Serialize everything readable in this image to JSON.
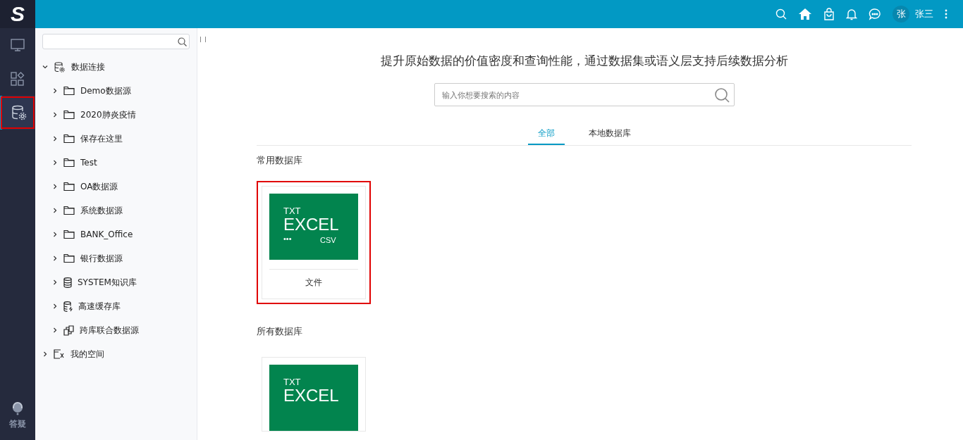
{
  "logo": {
    "letter": "S"
  },
  "header": {
    "user_avatar": "张",
    "user_name": "张三"
  },
  "nav": [
    {
      "kind": "monitor",
      "selected": false,
      "highlighted": false
    },
    {
      "kind": "apps",
      "selected": false,
      "highlighted": false
    },
    {
      "kind": "database-gear",
      "selected": true,
      "highlighted": true
    }
  ],
  "help": {
    "label": "答疑"
  },
  "tree": {
    "items": [
      {
        "label": "数据连接",
        "kind": "connection",
        "expanded": true,
        "children": [
          {
            "label": "Demo数据源",
            "kind": "folder",
            "expanded": false
          },
          {
            "label": "2020肺炎疫情",
            "kind": "folder",
            "expanded": false
          },
          {
            "label": "保存在这里",
            "kind": "folder",
            "expanded": false
          },
          {
            "label": "Test",
            "kind": "folder",
            "expanded": false
          },
          {
            "label": "OA数据源",
            "kind": "folder",
            "expanded": false
          },
          {
            "label": "系统数据源",
            "kind": "folder",
            "expanded": false
          },
          {
            "label": "BANK_Office",
            "kind": "folder",
            "expanded": false
          },
          {
            "label": "银行数据源",
            "kind": "folder",
            "expanded": false
          },
          {
            "label": "SYSTEM知识库",
            "kind": "database",
            "expanded": false
          },
          {
            "label": "高速缓存库",
            "kind": "cache",
            "expanded": false
          },
          {
            "label": "跨库联合数据源",
            "kind": "federated",
            "expanded": false
          }
        ]
      },
      {
        "label": "我的空间",
        "kind": "space",
        "expanded": false
      }
    ]
  },
  "main": {
    "headline": "提升原始数据的价值密度和查询性能，通过数据集或语义层支持后续数据分析",
    "search": {
      "placeholder": "输入你想要搜索的内容"
    },
    "tabs": [
      {
        "label": "全部",
        "selected": true
      },
      {
        "label": "本地数据库",
        "selected": false
      }
    ],
    "sections": [
      {
        "title": "常用数据库",
        "cards": [
          {
            "tile_lines": [
              "TXT",
              "EXCEL",
              "•••",
              "CSV"
            ],
            "label": "文件",
            "highlighted": true
          }
        ]
      },
      {
        "title": "所有数据库",
        "cards": [
          {
            "tile_lines": [
              "TXT",
              "EXCEL"
            ],
            "highlighted": false
          }
        ]
      }
    ]
  }
}
